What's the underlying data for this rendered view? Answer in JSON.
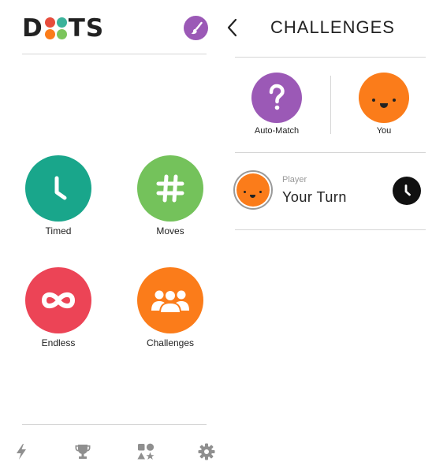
{
  "app": {
    "logo_left": "D",
    "logo_right": "TS",
    "logo_dot_colors": [
      "#e74c3c",
      "#3bb39b",
      "#fb7c1a",
      "#7cc55c"
    ]
  },
  "modes": [
    {
      "label": "Timed",
      "color": "#19a68b",
      "icon": "clock-icon"
    },
    {
      "label": "Moves",
      "color": "#74c25b",
      "icon": "hash-icon"
    },
    {
      "label": "Endless",
      "color": "#ec4456",
      "icon": "infinity-icon"
    },
    {
      "label": "Challenges",
      "color": "#fb7c1a",
      "icon": "people-icon"
    }
  ],
  "bottom_nav": [
    "lightning-icon",
    "trophy-icon",
    "shapes-icon",
    "gear-icon"
  ],
  "challenges": {
    "title": "CHALLENGES",
    "opponents": [
      {
        "label": "Auto-Match",
        "color": "#9b59b6",
        "icon": "question-icon"
      },
      {
        "label": "You",
        "color": "#fb7c1a",
        "icon": "face-icon"
      }
    ],
    "games": [
      {
        "player_label": "Player",
        "status": "Your Turn",
        "avatar_color": "#fb7c1a",
        "status_icon": "clock-icon"
      }
    ]
  },
  "colors": {
    "theme_button": "#9b59b6",
    "divider": "#d6d6d6"
  }
}
